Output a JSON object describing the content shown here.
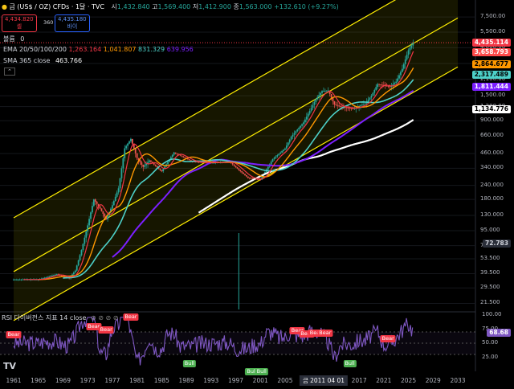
{
  "header": {
    "title": "금 (US$ / OZ) CFDs · 1달 · TVC",
    "ohlc": {
      "open_label": "시",
      "open": "1,432.840",
      "high_label": "고",
      "high": "1,569.400",
      "low_label": "저",
      "low": "1,412.900",
      "close_label": "종",
      "close": "1,563.000",
      "change": "+132.610 (+9.27%)"
    },
    "sell": {
      "price": "4,434.820",
      "label": "셀"
    },
    "spread": "360",
    "buy": {
      "price": "4,435.180",
      "label": "바이"
    },
    "volume_label": "볼륨",
    "volume_value": "0",
    "ema": {
      "label": "EMA 20/50/100/200",
      "v20": "1,263.164",
      "v50": "1,041.807",
      "v100": "831.329",
      "v200": "639.956"
    },
    "sma": {
      "label": "SMA 365 close",
      "value": "463.766"
    }
  },
  "price_labels": [
    {
      "value": "4,435.114",
      "color": "#f23645",
      "text": "#ffffff"
    },
    {
      "value": "3,658.793",
      "color": "#ff4a4a",
      "text": "#ffffff"
    },
    {
      "value": "2,864.677",
      "color": "#ff9800",
      "text": "#000000"
    },
    {
      "value": "2,317.489",
      "color": "#4dd0c8",
      "text": "#000000"
    },
    {
      "value": "1,811.444",
      "color": "#7b1fff",
      "text": "#ffffff"
    },
    {
      "value": "1,134.776",
      "color": "#ffffff",
      "text": "#000000"
    },
    {
      "value": "72.783",
      "color": "#2a2e39",
      "text": "#d1d4dc"
    }
  ],
  "y_ticks": [
    "7,500.00",
    "5,500.00",
    "4,000.00",
    "2,900.00",
    "2,100.00",
    "1,500.00",
    "1,200.00",
    "900.000",
    "660.000",
    "460.000",
    "340.000",
    "240.000",
    "180.000",
    "130.000",
    "95.000",
    "70.000",
    "53.500",
    "39.500",
    "29.500",
    "21.500"
  ],
  "rsi": {
    "label": "RSI 다이버전스 지표 14 close",
    "ticks": [
      "100.00",
      "75.00",
      "50.00",
      "25.00"
    ],
    "value": "68.68",
    "bear_label": "Bear",
    "bull_label": "Bull"
  },
  "x_ticks": [
    "1961",
    "1965",
    "1969",
    "1973",
    "1977",
    "1981",
    "1985",
    "1989",
    "1993",
    "1997",
    "2001",
    "2005",
    "2009",
    "2013",
    "2017",
    "2021",
    "2025",
    "2029",
    "2033"
  ],
  "crosshair_date": "금 2011 04 01",
  "colors": {
    "up": "#26a69a",
    "down": "#ef5350",
    "ema20": "#f23645",
    "ema50": "#ff9800",
    "ema100": "#4dd0c8",
    "ema200": "#7b1fff",
    "sma365": "#ffffff",
    "channel": "#ffee00",
    "rsi": "#7e57c2"
  },
  "chart_data": {
    "type": "line",
    "title": "금 (US$ / OZ) CFDs · 1달 · TVC",
    "y_scale": "log",
    "x": [
      1960,
      1965,
      1968,
      1970,
      1971,
      1972,
      1973,
      1974,
      1975,
      1976,
      1977,
      1978,
      1979,
      1980,
      1981,
      1982,
      1983,
      1985,
      1987,
      1990,
      1993,
      1996,
      1999,
      2001,
      2003,
      2005,
      2006,
      2008,
      2009,
      2010,
      2011,
      2012,
      2013,
      2014,
      2016,
      2018,
      2019,
      2020,
      2022,
      2023,
      2024,
      2025,
      2025.8
    ],
    "series": [
      {
        "name": "금 (US$ / OZ) CFDs",
        "values": [
          35,
          35,
          39,
          36,
          42,
          64,
          106,
          180,
          150,
          120,
          160,
          226,
          512,
          620,
          420,
          350,
          400,
          320,
          470,
          390,
          380,
          390,
          280,
          270,
          410,
          510,
          650,
          870,
          1100,
          1400,
          1650,
          1670,
          1250,
          1200,
          1150,
          1280,
          1500,
          1900,
          1800,
          2000,
          2600,
          3800,
          4435
        ]
      }
    ],
    "rsi": {
      "name": "RSI 14 close",
      "ylim": [
        0,
        100
      ],
      "current": 68.68
    }
  }
}
